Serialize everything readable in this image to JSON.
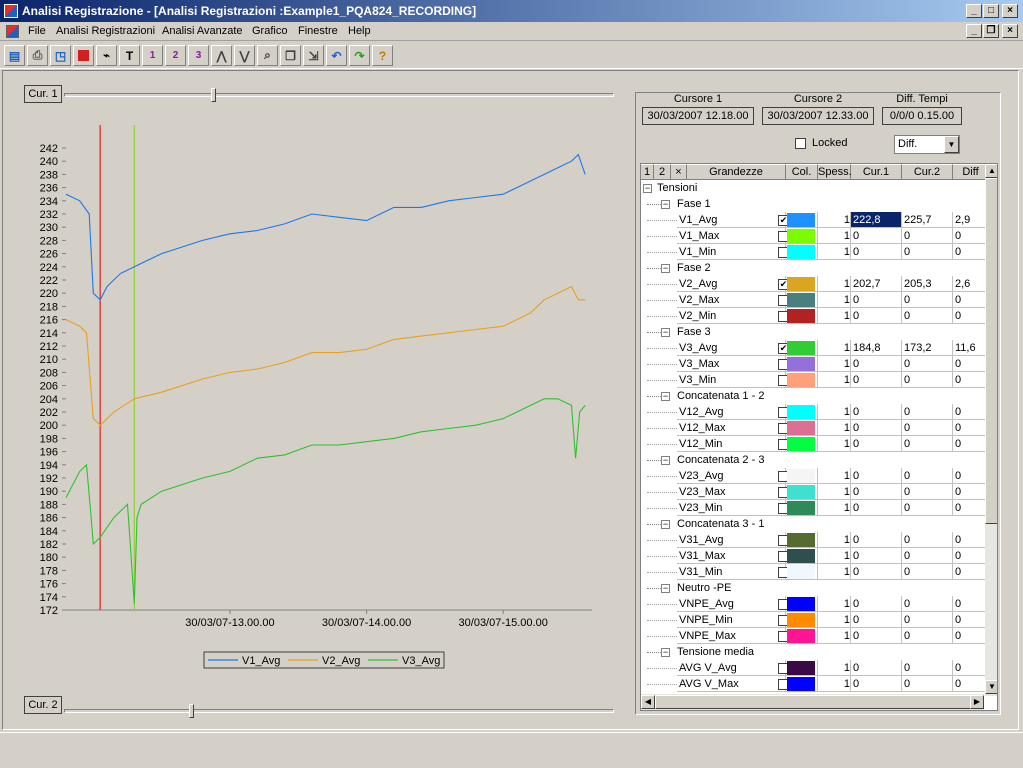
{
  "window": {
    "title": "Analisi Registrazione - [Analisi Registrazioni :Example1_PQA824_RECORDING]"
  },
  "menu": [
    "File",
    "Analisi Registrazioni",
    "Analisi Avanzate",
    "Grafico",
    "Finestre",
    "Help"
  ],
  "toolbar_icons": [
    "open-icon",
    "print-icon",
    "preview-icon",
    "stop-icon",
    "measure-icon",
    "text-icon",
    "marker1-icon",
    "marker2-icon",
    "marker3-icon",
    "peak-icon",
    "valley-icon",
    "zoom-icon",
    "copy-icon",
    "export-icon",
    "undo-icon",
    "redo-icon",
    "help-icon"
  ],
  "cursors": {
    "cur1_label": "Cur. 1",
    "cur2_label": "Cur. 2",
    "cur1_value": 0.27,
    "cur2_value": 0.23
  },
  "header": {
    "cursore1_label": "Cursore 1",
    "cursore1_value": "30/03/2007 12.18.00",
    "cursore2_label": "Cursore 2",
    "cursore2_value": "30/03/2007 12.33.00",
    "diff_label": "Diff. Tempi",
    "diff_value": "0/0/0 0.15.00",
    "locked_label": "Locked",
    "mode_value": "Diff."
  },
  "grid": {
    "columns": [
      "1",
      "2",
      "×",
      "Grandezze",
      "Col.",
      "Spess.",
      "Cur.1",
      "Cur.2",
      "Diff"
    ],
    "rows": [
      {
        "type": "group",
        "label": "Tensioni"
      },
      {
        "type": "sub",
        "label": "Fase 1"
      },
      {
        "type": "item",
        "name": "V1_Avg",
        "checked": true,
        "color": "#1e90ff",
        "spess": "1",
        "c1": "222,8",
        "c2": "225,7",
        "diff": "2,9",
        "sel": true
      },
      {
        "type": "item",
        "name": "V1_Max",
        "checked": false,
        "color": "#7cfc00",
        "spess": "1",
        "c1": "0",
        "c2": "0",
        "diff": "0"
      },
      {
        "type": "item",
        "name": "V1_Min",
        "checked": false,
        "color": "#00ffff",
        "spess": "1",
        "c1": "0",
        "c2": "0",
        "diff": "0"
      },
      {
        "type": "sub",
        "label": "Fase 2"
      },
      {
        "type": "item",
        "name": "V2_Avg",
        "checked": true,
        "color": "#daa520",
        "spess": "1",
        "c1": "202,7",
        "c2": "205,3",
        "diff": "2,6"
      },
      {
        "type": "item",
        "name": "V2_Max",
        "checked": false,
        "color": "#4a7f7f",
        "spess": "1",
        "c1": "0",
        "c2": "0",
        "diff": "0"
      },
      {
        "type": "item",
        "name": "V2_Min",
        "checked": false,
        "color": "#b22222",
        "spess": "1",
        "c1": "0",
        "c2": "0",
        "diff": "0"
      },
      {
        "type": "sub",
        "label": "Fase 3"
      },
      {
        "type": "item",
        "name": "V3_Avg",
        "checked": true,
        "color": "#32cd32",
        "spess": "1",
        "c1": "184,8",
        "c2": "173,2",
        "diff": "11,6"
      },
      {
        "type": "item",
        "name": "V3_Max",
        "checked": false,
        "color": "#9370db",
        "spess": "1",
        "c1": "0",
        "c2": "0",
        "diff": "0"
      },
      {
        "type": "item",
        "name": "V3_Min",
        "checked": false,
        "color": "#ffa07a",
        "spess": "1",
        "c1": "0",
        "c2": "0",
        "diff": "0"
      },
      {
        "type": "sub",
        "label": "Concatenata 1 - 2"
      },
      {
        "type": "item",
        "name": "V12_Avg",
        "checked": false,
        "color": "#00ffff",
        "spess": "1",
        "c1": "0",
        "c2": "0",
        "diff": "0"
      },
      {
        "type": "item",
        "name": "V12_Max",
        "checked": false,
        "color": "#db7093",
        "spess": "1",
        "c1": "0",
        "c2": "0",
        "diff": "0"
      },
      {
        "type": "item",
        "name": "V12_Min",
        "checked": false,
        "color": "#00ff40",
        "spess": "1",
        "c1": "0",
        "c2": "0",
        "diff": "0"
      },
      {
        "type": "sub",
        "label": "Concatenata 2 - 3"
      },
      {
        "type": "item",
        "name": "V23_Avg",
        "checked": false,
        "color": "#f5f5f5",
        "spess": "1",
        "c1": "0",
        "c2": "0",
        "diff": "0"
      },
      {
        "type": "item",
        "name": "V23_Max",
        "checked": false,
        "color": "#40e0d0",
        "spess": "1",
        "c1": "0",
        "c2": "0",
        "diff": "0"
      },
      {
        "type": "item",
        "name": "V23_Min",
        "checked": false,
        "color": "#2e8b57",
        "spess": "1",
        "c1": "0",
        "c2": "0",
        "diff": "0"
      },
      {
        "type": "sub",
        "label": "Concatenata 3 - 1"
      },
      {
        "type": "item",
        "name": "V31_Avg",
        "checked": false,
        "color": "#556b2f",
        "spess": "1",
        "c1": "0",
        "c2": "0",
        "diff": "0"
      },
      {
        "type": "item",
        "name": "V31_Max",
        "checked": false,
        "color": "#2f4f4f",
        "spess": "1",
        "c1": "0",
        "c2": "0",
        "diff": "0"
      },
      {
        "type": "item",
        "name": "V31_Min",
        "checked": false,
        "color": "#f0f8ff",
        "spess": "1",
        "c1": "0",
        "c2": "0",
        "diff": "0"
      },
      {
        "type": "sub",
        "label": "Neutro -PE"
      },
      {
        "type": "item",
        "name": "VNPE_Avg",
        "checked": false,
        "color": "#0000ff",
        "spess": "1",
        "c1": "0",
        "c2": "0",
        "diff": "0"
      },
      {
        "type": "item",
        "name": "VNPE_Min",
        "checked": false,
        "color": "#ff8c00",
        "spess": "1",
        "c1": "0",
        "c2": "0",
        "diff": "0"
      },
      {
        "type": "item",
        "name": "VNPE_Max",
        "checked": false,
        "color": "#ff1493",
        "spess": "1",
        "c1": "0",
        "c2": "0",
        "diff": "0"
      },
      {
        "type": "sub",
        "label": "Tensione media"
      },
      {
        "type": "item",
        "name": "AVG V_Avg",
        "checked": false,
        "color": "#3b0a45",
        "spess": "1",
        "c1": "0",
        "c2": "0",
        "diff": "0"
      },
      {
        "type": "item",
        "name": "AVG V_Max",
        "checked": false,
        "color": "#0000ff",
        "spess": "1",
        "c1": "0",
        "c2": "0",
        "diff": "0"
      }
    ]
  },
  "chart_data": {
    "type": "line",
    "yticks": [
      172,
      174,
      176,
      178,
      180,
      182,
      184,
      186,
      188,
      190,
      192,
      194,
      196,
      198,
      200,
      202,
      204,
      206,
      208,
      210,
      212,
      214,
      216,
      218,
      220,
      222,
      224,
      226,
      228,
      230,
      232,
      234,
      236,
      238,
      240,
      242
    ],
    "ylim": [
      172,
      242
    ],
    "xticks": [
      "30/03/07-13.00.00",
      "30/03/07-14.00.00",
      "30/03/07-15.00.00"
    ],
    "xtick_pos": [
      1.0,
      2.0,
      3.0
    ],
    "xlim": [
      -0.2,
      3.65
    ],
    "cursor1_x": 0.05,
    "cursor2_x": 0.3,
    "series": [
      {
        "name": "V1_Avg",
        "color": "#1e78e6",
        "x": [
          -0.2,
          -0.1,
          -0.03,
          0.0,
          0.05,
          0.1,
          0.2,
          0.3,
          0.5,
          0.8,
          1.0,
          1.2,
          1.4,
          1.6,
          1.8,
          2.0,
          2.2,
          2.4,
          2.6,
          2.8,
          3.0,
          3.1,
          3.2,
          3.3,
          3.4,
          3.5,
          3.55,
          3.6
        ],
        "y": [
          235,
          234,
          232,
          220,
          219,
          221,
          223,
          224,
          226,
          228,
          229,
          229.5,
          230.5,
          232,
          231.5,
          231,
          233,
          233,
          234,
          234.5,
          235,
          236,
          237,
          238,
          239,
          240,
          241,
          238
        ]
      },
      {
        "name": "V2_Avg",
        "color": "#e8a020",
        "x": [
          -0.2,
          -0.1,
          -0.05,
          0.0,
          0.05,
          0.15,
          0.3,
          0.5,
          0.8,
          1.0,
          1.2,
          1.4,
          1.6,
          1.8,
          2.0,
          2.2,
          2.4,
          2.6,
          2.8,
          3.0,
          3.1,
          3.2,
          3.3,
          3.4,
          3.5,
          3.55,
          3.6
        ],
        "y": [
          216,
          215,
          214,
          201,
          200,
          202,
          204,
          205,
          207,
          208,
          208.5,
          209.5,
          211,
          211,
          211.5,
          213,
          213.5,
          214,
          214.5,
          215,
          216,
          217,
          219,
          220,
          221,
          219,
          219
        ]
      },
      {
        "name": "V3_Avg",
        "color": "#30c030",
        "x": [
          -0.2,
          -0.1,
          -0.05,
          -0.02,
          0.0,
          0.05,
          0.15,
          0.25,
          0.3,
          0.32,
          0.35,
          0.5,
          0.8,
          1.0,
          1.2,
          1.4,
          1.6,
          1.8,
          2.0,
          2.2,
          2.4,
          2.6,
          2.8,
          3.0,
          3.1,
          3.2,
          3.3,
          3.4,
          3.5,
          3.53,
          3.56,
          3.6
        ],
        "y": [
          189,
          193,
          194,
          187,
          182,
          183,
          186,
          188,
          173,
          186,
          188,
          190,
          192,
          193,
          195,
          195.5,
          197,
          197,
          197.5,
          198,
          199,
          199.5,
          200,
          201,
          202,
          203,
          204,
          204,
          203,
          195,
          202,
          203
        ]
      }
    ],
    "legend": [
      "V1_Avg",
      "V2_Avg",
      "V3_Avg"
    ]
  }
}
